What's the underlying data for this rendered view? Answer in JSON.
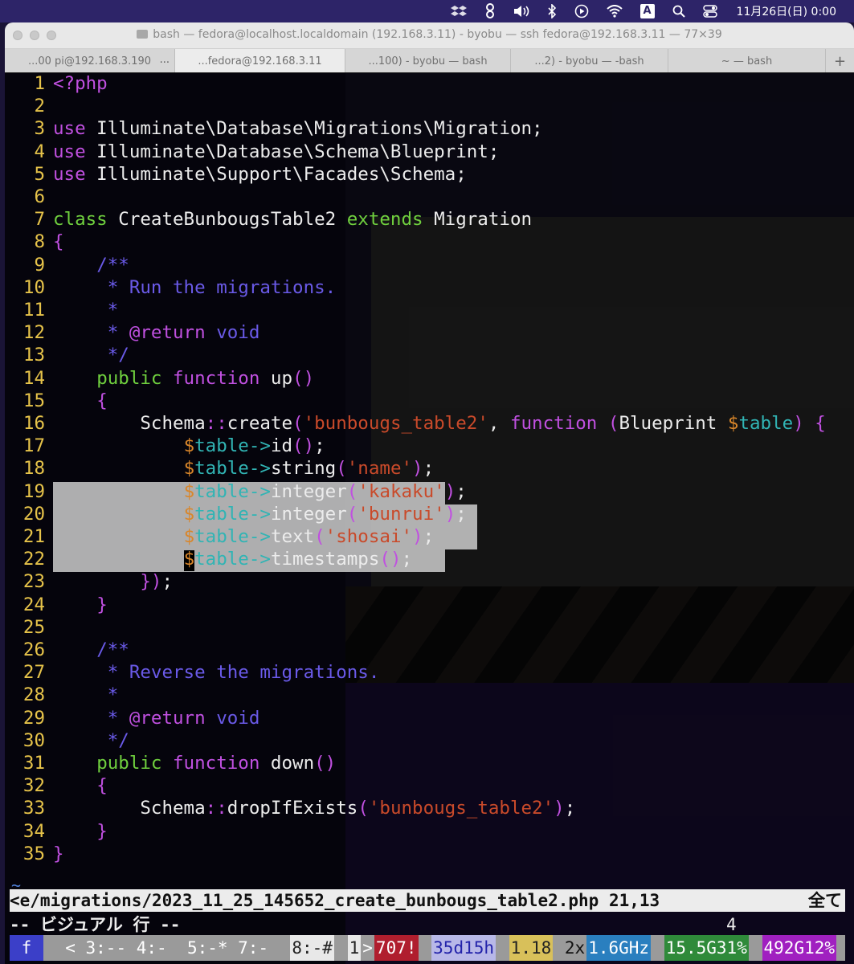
{
  "menubar": {
    "icons": [
      "dropbox-icon",
      "evernote-icon",
      "volume-icon",
      "bluetooth-icon",
      "play-icon",
      "wifi-icon",
      "input-source-icon",
      "search-icon",
      "control-center-icon"
    ],
    "input_source": "A",
    "clock": "11月26日(日) 0:00"
  },
  "window": {
    "title": "bash — fedora@localhost.localdomain (192.168.3.11) - byobu — ssh fedora@192.168.3.11 — 77×39",
    "tabs": [
      {
        "label": "...00 pi@192.168.3.190",
        "active": false
      },
      {
        "label": "...fedora@192.168.3.11",
        "active": true
      },
      {
        "label": "...100) - byobu — bash",
        "active": false
      },
      {
        "label": "...2) - byobu — -bash",
        "active": false
      },
      {
        "label": "~ — bash",
        "active": false
      }
    ],
    "tab_more": "...",
    "new_tab": "+"
  },
  "editor": {
    "colors": {
      "keyword": "#6fcf3e",
      "purple": "#c050e0",
      "comment": "#6a5ae8",
      "string": "#c94a2a",
      "var": "#d9862a",
      "arrow": "#31b4b4",
      "lineno": "#e6c34a"
    },
    "lines": [
      {
        "n": "1",
        "tokens": [
          [
            "purple",
            "<?php"
          ]
        ]
      },
      {
        "n": "2",
        "tokens": []
      },
      {
        "n": "3",
        "tokens": [
          [
            "purple",
            "use"
          ],
          [
            "plain",
            " Illuminate\\Database\\Migrations\\Migration;"
          ]
        ]
      },
      {
        "n": "4",
        "tokens": [
          [
            "purple",
            "use"
          ],
          [
            "plain",
            " Illuminate\\Database\\Schema\\Blueprint;"
          ]
        ]
      },
      {
        "n": "5",
        "tokens": [
          [
            "purple",
            "use"
          ],
          [
            "plain",
            " Illuminate\\Support\\Facades\\Schema;"
          ]
        ]
      },
      {
        "n": "6",
        "tokens": []
      },
      {
        "n": "7",
        "tokens": [
          [
            "keyword",
            "class"
          ],
          [
            "plain",
            " CreateBunbougsTable2 "
          ],
          [
            "keyword",
            "extends"
          ],
          [
            "plain",
            " Migration"
          ]
        ]
      },
      {
        "n": "8",
        "tokens": [
          [
            "purple",
            "{"
          ]
        ]
      },
      {
        "n": "9",
        "tokens": [
          [
            "plain",
            "    "
          ],
          [
            "comment",
            "/**"
          ]
        ]
      },
      {
        "n": "10",
        "tokens": [
          [
            "plain",
            "     "
          ],
          [
            "comment",
            "* Run the migrations."
          ]
        ]
      },
      {
        "n": "11",
        "tokens": [
          [
            "plain",
            "     "
          ],
          [
            "comment",
            "*"
          ]
        ]
      },
      {
        "n": "12",
        "tokens": [
          [
            "plain",
            "     "
          ],
          [
            "comment",
            "* "
          ],
          [
            "purple",
            "@return"
          ],
          [
            "comment",
            " void"
          ]
        ]
      },
      {
        "n": "13",
        "tokens": [
          [
            "plain",
            "     "
          ],
          [
            "comment",
            "*/"
          ]
        ]
      },
      {
        "n": "14",
        "tokens": [
          [
            "plain",
            "    "
          ],
          [
            "keyword",
            "public"
          ],
          [
            "plain",
            " "
          ],
          [
            "purple",
            "function"
          ],
          [
            "plain",
            " up"
          ],
          [
            "purple",
            "()"
          ]
        ]
      },
      {
        "n": "15",
        "tokens": [
          [
            "plain",
            "    "
          ],
          [
            "purple",
            "{"
          ]
        ]
      },
      {
        "n": "16",
        "tokens": [
          [
            "plain",
            "        Schema"
          ],
          [
            "purple",
            "::"
          ],
          [
            "plain",
            "create"
          ],
          [
            "purple",
            "("
          ],
          [
            "string",
            "'bunbougs_table2'"
          ],
          [
            "plain",
            ", "
          ],
          [
            "purple",
            "function"
          ],
          [
            "plain",
            " "
          ],
          [
            "purple",
            "("
          ],
          [
            "plain",
            "Blueprint "
          ],
          [
            "var",
            "$"
          ],
          [
            "arrow",
            "table"
          ],
          [
            "purple",
            ")"
          ],
          [
            "plain",
            " "
          ],
          [
            "purple",
            "{"
          ]
        ]
      },
      {
        "n": "17",
        "tokens": [
          [
            "plain",
            "            "
          ],
          [
            "var",
            "$"
          ],
          [
            "arrow",
            "table->"
          ],
          [
            "plain",
            "id"
          ],
          [
            "purple",
            "()"
          ],
          [
            "plain",
            ";"
          ]
        ]
      },
      {
        "n": "18",
        "tokens": [
          [
            "plain",
            "            "
          ],
          [
            "var",
            "$"
          ],
          [
            "arrow",
            "table->"
          ],
          [
            "plain",
            "string"
          ],
          [
            "purple",
            "("
          ],
          [
            "string",
            "'name'"
          ],
          [
            "purple",
            ")"
          ],
          [
            "plain",
            ";"
          ]
        ]
      },
      {
        "n": "19",
        "tokens": [
          [
            "plain",
            "            "
          ],
          [
            "var",
            "$"
          ],
          [
            "arrow",
            "table->"
          ],
          [
            "plain",
            "integer"
          ],
          [
            "purple",
            "("
          ],
          [
            "string",
            "'kakaku'"
          ],
          [
            "purple",
            ")"
          ],
          [
            "plain",
            ";"
          ]
        ]
      },
      {
        "n": "20",
        "tokens": [
          [
            "plain",
            "            "
          ],
          [
            "var",
            "$"
          ],
          [
            "arrow",
            "table->"
          ],
          [
            "plain",
            "integer"
          ],
          [
            "purple",
            "("
          ],
          [
            "string",
            "'bunrui'"
          ],
          [
            "purple",
            ")"
          ],
          [
            "plain",
            ";"
          ]
        ]
      },
      {
        "n": "21",
        "tokens": [
          [
            "plain",
            "            "
          ],
          [
            "var",
            "$"
          ],
          [
            "arrow",
            "table->"
          ],
          [
            "plain",
            "text"
          ],
          [
            "purple",
            "("
          ],
          [
            "string",
            "'shosai'"
          ],
          [
            "purple",
            ")"
          ],
          [
            "plain",
            ";"
          ]
        ]
      },
      {
        "n": "22",
        "tokens": [
          [
            "plain",
            "            "
          ],
          [
            "var",
            "$"
          ],
          [
            "arrow",
            "table->"
          ],
          [
            "plain",
            "timestamps"
          ],
          [
            "purple",
            "()"
          ],
          [
            "plain",
            ";"
          ]
        ]
      },
      {
        "n": "23",
        "tokens": [
          [
            "plain",
            "        "
          ],
          [
            "purple",
            "})"
          ],
          [
            "plain",
            ";"
          ]
        ]
      },
      {
        "n": "24",
        "tokens": [
          [
            "plain",
            "    "
          ],
          [
            "purple",
            "}"
          ]
        ]
      },
      {
        "n": "25",
        "tokens": []
      },
      {
        "n": "26",
        "tokens": [
          [
            "plain",
            "    "
          ],
          [
            "comment",
            "/**"
          ]
        ]
      },
      {
        "n": "27",
        "tokens": [
          [
            "plain",
            "     "
          ],
          [
            "comment",
            "* Reverse the migrations."
          ]
        ]
      },
      {
        "n": "28",
        "tokens": [
          [
            "plain",
            "     "
          ],
          [
            "comment",
            "*"
          ]
        ]
      },
      {
        "n": "29",
        "tokens": [
          [
            "plain",
            "     "
          ],
          [
            "comment",
            "* "
          ],
          [
            "purple",
            "@return"
          ],
          [
            "comment",
            " void"
          ]
        ]
      },
      {
        "n": "30",
        "tokens": [
          [
            "plain",
            "     "
          ],
          [
            "comment",
            "*/"
          ]
        ]
      },
      {
        "n": "31",
        "tokens": [
          [
            "plain",
            "    "
          ],
          [
            "keyword",
            "public"
          ],
          [
            "plain",
            " "
          ],
          [
            "purple",
            "function"
          ],
          [
            "plain",
            " down"
          ],
          [
            "purple",
            "()"
          ]
        ]
      },
      {
        "n": "32",
        "tokens": [
          [
            "plain",
            "    "
          ],
          [
            "purple",
            "{"
          ]
        ]
      },
      {
        "n": "33",
        "tokens": [
          [
            "plain",
            "        Schema"
          ],
          [
            "purple",
            "::"
          ],
          [
            "plain",
            "dropIfExists"
          ],
          [
            "purple",
            "("
          ],
          [
            "string",
            "'bunbougs_table2'"
          ],
          [
            "purple",
            ")"
          ],
          [
            "plain",
            ";"
          ]
        ]
      },
      {
        "n": "34",
        "tokens": [
          [
            "plain",
            "    "
          ],
          [
            "purple",
            "}"
          ]
        ]
      },
      {
        "n": "35",
        "tokens": [
          [
            "purple",
            "}"
          ]
        ]
      }
    ],
    "tilde": "~",
    "status_path": "<e/migrations/2023_11_25_145652_create_bunbougs_table2.php 21,13",
    "status_right": "全て",
    "mode": "-- ビジュアル 行 --",
    "selection_count": "4"
  },
  "byobu": [
    {
      "text": " f ",
      "bg": "#3b3fc8",
      "fg": "#ffffff"
    },
    {
      "text": "  < 3:-- 4:-  5:-* 7:-  ",
      "bg": "#9a9a9a",
      "fg": "#ffffff"
    },
    {
      "text": "8:-#",
      "bg": "#e8e8e8",
      "fg": "#222222"
    },
    {
      "text": " ",
      "bg": "#9a9a9a",
      "fg": "#ffffff"
    },
    {
      "text": "1",
      "bg": "#e8e8e8",
      "fg": "#222222"
    },
    {
      "text": ">",
      "bg": "#9a9a9a",
      "fg": "#ffffff"
    },
    {
      "text": "707!",
      "bg": "#b01e2e",
      "fg": "#ffffff"
    },
    {
      "text": " ",
      "bg": "#9a9a9a",
      "fg": "#ffffff"
    },
    {
      "text": "35d15h",
      "bg": "#b8b8e8",
      "fg": "#2222aa"
    },
    {
      "text": " ",
      "bg": "#9a9a9a",
      "fg": "#ffffff"
    },
    {
      "text": "1.18",
      "bg": "#d8c05a",
      "fg": "#222222"
    },
    {
      "text": " 2x",
      "bg": "#9a9a9a",
      "fg": "#111111"
    },
    {
      "text": "1.6GHz",
      "bg": "#2a7fbf",
      "fg": "#ffffff"
    },
    {
      "text": " ",
      "bg": "#9a9a9a",
      "fg": "#ffffff"
    },
    {
      "text": "15.5G31%",
      "bg": "#2f8a3a",
      "fg": "#ffffff"
    },
    {
      "text": " ",
      "bg": "#9a9a9a",
      "fg": "#ffffff"
    },
    {
      "text": "492G12%",
      "bg": "#a020c0",
      "fg": "#ffffff"
    }
  ]
}
